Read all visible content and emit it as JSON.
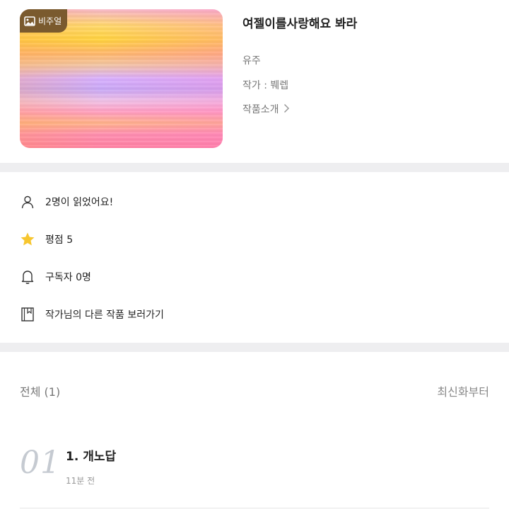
{
  "work": {
    "badge_label": "비주얼",
    "title": "여젤이를사랑해요 봐라",
    "subtitle": "유주",
    "author_label": "작가 : 붸렙",
    "intro_label": "작품소개"
  },
  "info": {
    "readers": "2명이 읽었어요!",
    "rating": "평점 5",
    "subscribers": "구독자 0명",
    "author_works": "작가님의 다른 작품 보러가기"
  },
  "episodes_header": {
    "total": "전체 (1)",
    "sort": "최신화부터"
  },
  "episodes": [
    {
      "number": "01",
      "title": "1. 개노답",
      "time": "11분 전"
    }
  ],
  "colors": {
    "badge": "#7a5a2e",
    "star": "#f7c62f",
    "divider": "#eeeef0"
  }
}
